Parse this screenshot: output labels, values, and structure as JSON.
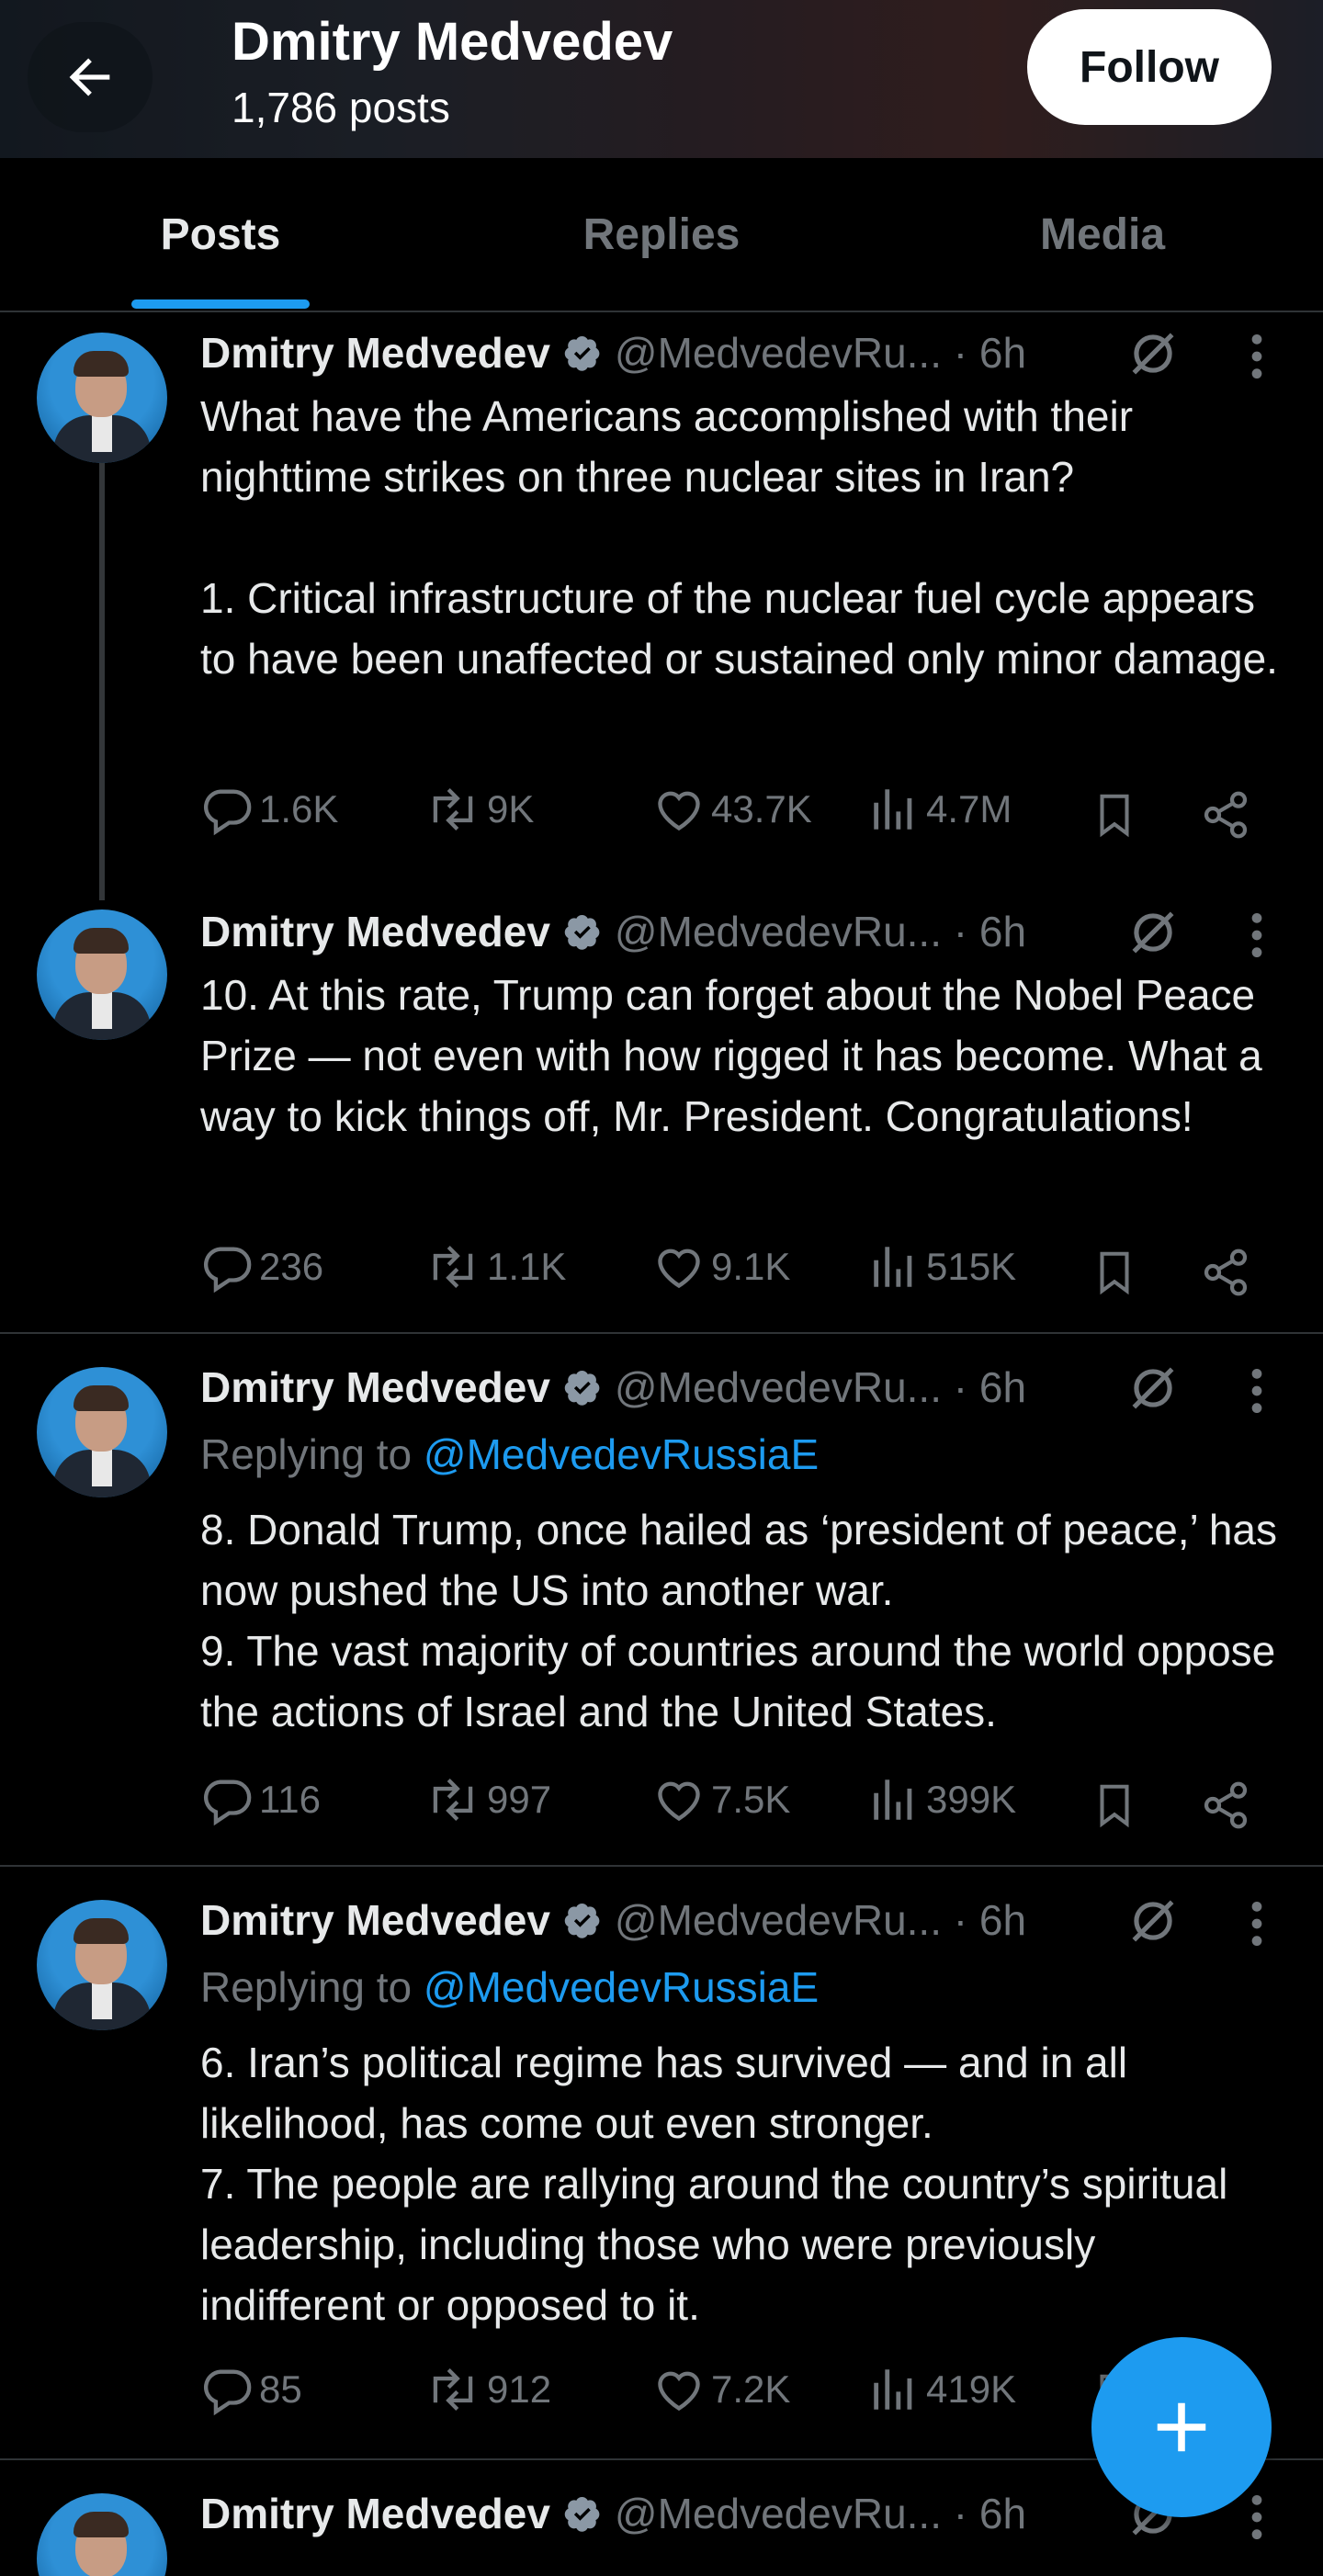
{
  "header": {
    "title": "Dmitry Medvedev",
    "subtitle": "1,786 posts",
    "follow_label": "Follow"
  },
  "tabs": [
    {
      "label": "Posts",
      "active": true
    },
    {
      "label": "Replies",
      "active": false
    },
    {
      "label": "Media",
      "active": false
    }
  ],
  "posts": [
    {
      "name": "Dmitry Medvedev",
      "handle": "@MedvedevRu... · 6h",
      "reply_to": "",
      "text": "What have the Americans accomplished with their nighttime strikes on three nuclear sites in Iran?\n\n1. Critical infrastructure of the nuclear fuel cycle appears to have been unaffected or sustained only minor damage.",
      "replies": "1.6K",
      "reposts": "9K",
      "likes": "43.7K",
      "views": "4.7M"
    },
    {
      "name": "Dmitry Medvedev",
      "handle": "@MedvedevRu... · 6h",
      "reply_to": "",
      "text": "10. At this rate, Trump can forget about the Nobel Peace Prize — not even with how rigged it has become. What a way to kick things off, Mr. President. Congratulations!",
      "replies": "236",
      "reposts": "1.1K",
      "likes": "9.1K",
      "views": "515K"
    },
    {
      "name": "Dmitry Medvedev",
      "handle": "@MedvedevRu... · 6h",
      "reply_to_prefix": "Replying to ",
      "reply_to": "@MedvedevRussiaE",
      "text": "8. Donald Trump, once hailed as ‘president of peace,’ has now pushed the US into another war.\n9. The vast majority of countries around the world oppose the actions of Israel and the United States.",
      "replies": "116",
      "reposts": "997",
      "likes": "7.5K",
      "views": "399K"
    },
    {
      "name": "Dmitry Medvedev",
      "handle": "@MedvedevRu... · 6h",
      "reply_to_prefix": "Replying to ",
      "reply_to": "@MedvedevRussiaE",
      "text": "6. Iran’s political regime has survived — and in all likelihood, has come out even stronger.\n7. The people are rallying around the country’s spiritual leadership, including those who were previously indifferent or opposed to it.",
      "replies": "85",
      "reposts": "912",
      "likes": "7.2K",
      "views": "419K"
    },
    {
      "name": "Dmitry Medvedev",
      "handle": "@MedvedevRu... · 6h"
    }
  ],
  "colors": {
    "accent": "#1d9bf0",
    "muted": "#71767b",
    "text": "#e7e9ea",
    "background": "#000000"
  }
}
